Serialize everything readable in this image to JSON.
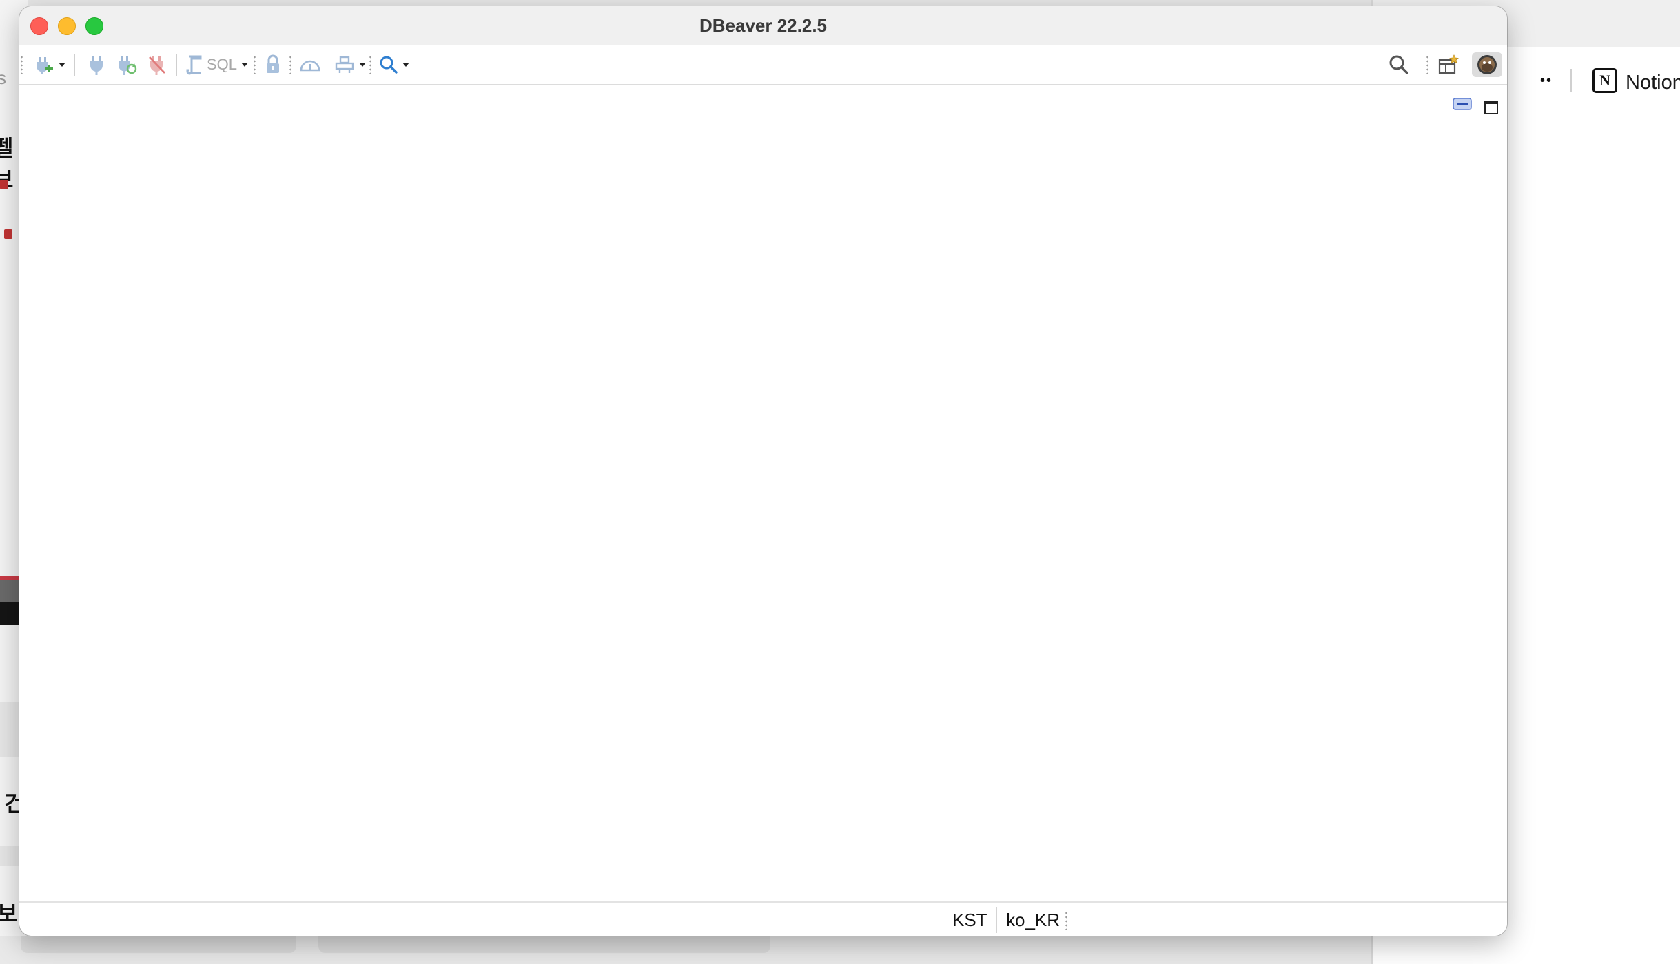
{
  "window": {
    "title": "DBeaver 22.2.5"
  },
  "toolbar": {
    "sql_label": "SQL",
    "icons": [
      "new-connection-icon",
      "connect-icon",
      "reconnect-icon",
      "disconnect-icon",
      "sql-editor-icon",
      "transaction-lock-icon",
      "commit-mode-icon",
      "tools-icon",
      "search-icon",
      "global-search-icon",
      "open-perspective-icon",
      "perspective-avatar-icon"
    ]
  },
  "panel": {
    "controls": [
      "minimize-panel-icon",
      "maximize-panel-icon"
    ]
  },
  "status": {
    "timezone": "KST",
    "locale": "ko_KR"
  },
  "background": {
    "notion_label": "Notion 사",
    "left_fragments": [
      "s",
      "펠보",
      "건",
      "보"
    ]
  },
  "colors": {
    "traffic_close": "#fe5f57",
    "traffic_min": "#febc2e",
    "traffic_max": "#28c840",
    "accent_blue": "#2f7fd0"
  }
}
